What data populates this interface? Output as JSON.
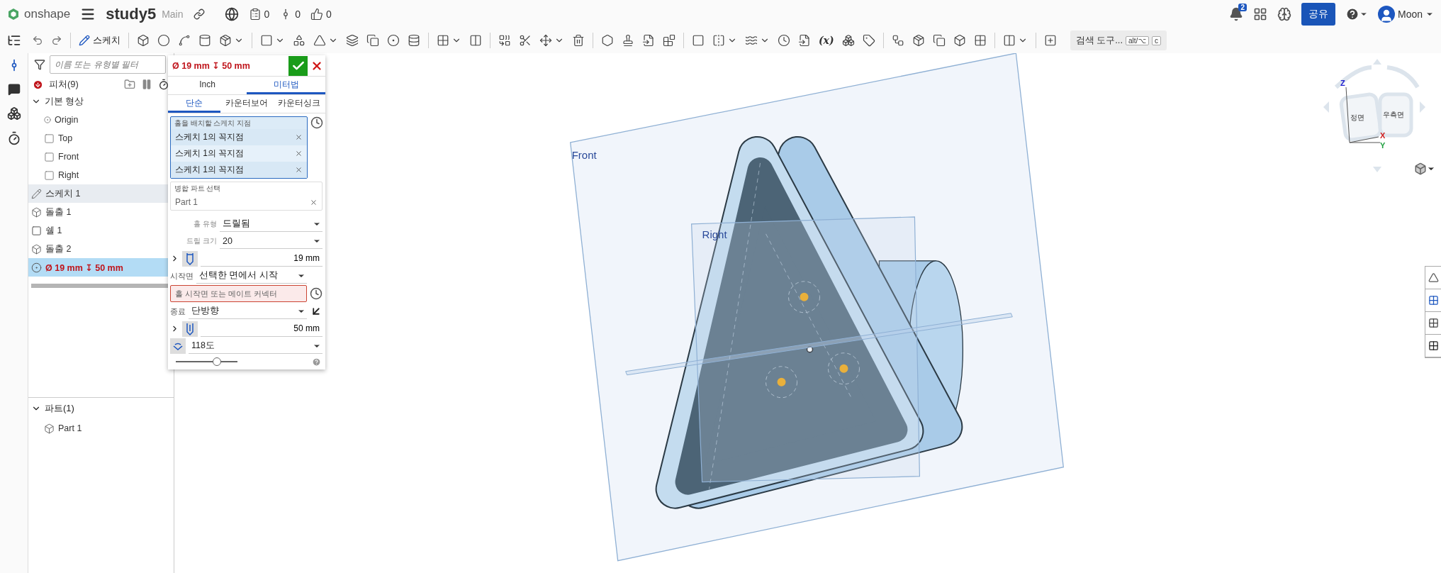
{
  "top_bar": {
    "logo": "onshape",
    "document_name": "study5",
    "branch": "Main",
    "counters": [
      {
        "kind": "versions",
        "count": "0"
      },
      {
        "kind": "branches",
        "count": "0"
      },
      {
        "kind": "likes",
        "count": "0"
      }
    ],
    "notification_count": "2",
    "share_button": "공유",
    "user_name": "Moon"
  },
  "toolbar": {
    "sketch_button": "스케치",
    "variables_button": "(x)",
    "search": {
      "label": "검색 도구...",
      "shortcut_keys": [
        "alt/⌥",
        "c"
      ]
    }
  },
  "feature_panel": {
    "filter": {
      "placeholder": "이름 또는 유형별 필터"
    },
    "features_title": "피처(9)",
    "features": [
      {
        "kind": "group",
        "label": "기본 형상",
        "expanded": true,
        "highlighted": false,
        "selected": false,
        "children": [
          {
            "kind": "origin",
            "label": "Origin"
          },
          {
            "kind": "plane",
            "label": "Top"
          },
          {
            "kind": "plane",
            "label": "Front"
          },
          {
            "kind": "plane",
            "label": "Right"
          }
        ]
      },
      {
        "kind": "sketch",
        "label": "스케치 1",
        "highlighted": true,
        "selected": false
      },
      {
        "kind": "extrude",
        "label": "돌출 1",
        "highlighted": false,
        "selected": false
      },
      {
        "kind": "shell",
        "label": "쉘 1",
        "highlighted": false,
        "selected": false
      },
      {
        "kind": "extrude",
        "label": "돌출 2",
        "highlighted": false,
        "selected": false
      },
      {
        "kind": "hole",
        "label": "Ø 19 mm ↧ 50 mm",
        "highlighted": false,
        "selected": true
      }
    ],
    "parts_section": {
      "title": "파트(1)",
      "expanded": true,
      "parts": [
        {
          "label": "Part 1"
        }
      ]
    }
  },
  "hole_dialog": {
    "title": "Ø 19 mm ↧ 50 mm",
    "unit_tabs": [
      {
        "label": "Inch",
        "selected": false
      },
      {
        "label": "미터법",
        "selected": true
      }
    ],
    "style_tabs": [
      {
        "label": "단순",
        "selected": true
      },
      {
        "label": "카운터보어",
        "selected": false
      },
      {
        "label": "카운터싱크",
        "selected": false
      }
    ],
    "sketch_points": {
      "label": "홀을 배치할 스케치 지점",
      "items": [
        "스케치 1의 꼭지점",
        "스케치 1의 꼭지점",
        "스케치 1의 꼭지점"
      ]
    },
    "merge_parts": {
      "label": "병합 파트 선택",
      "items": [
        "Part 1"
      ]
    },
    "fields": [
      {
        "kind": "labeled_select",
        "label": "홀 유형",
        "value": "드릴됨"
      },
      {
        "kind": "labeled_select",
        "label": "드릴 크기",
        "value": "20"
      },
      {
        "kind": "diameter",
        "expanded": false,
        "value": "19 mm"
      },
      {
        "kind": "inline_select",
        "label": "시작면",
        "value": "선택한 면에서 시작"
      },
      {
        "kind": "error",
        "placeholder": "홀 시작면 또는 메이트 커넥터"
      },
      {
        "kind": "flip_select",
        "label": "종료",
        "value": "단방향"
      },
      {
        "kind": "depth",
        "expanded": false,
        "value": "50 mm"
      },
      {
        "kind": "angle",
        "value": "118도"
      },
      {
        "kind": "slider",
        "level": 0.67
      }
    ]
  },
  "viewport": {
    "planes": [
      {
        "label": "Front"
      },
      {
        "label": "Right"
      }
    ],
    "view_cube": {
      "faces": [
        "정면",
        "우측면"
      ],
      "axes": [
        "Z",
        "X",
        "Y"
      ]
    }
  }
}
